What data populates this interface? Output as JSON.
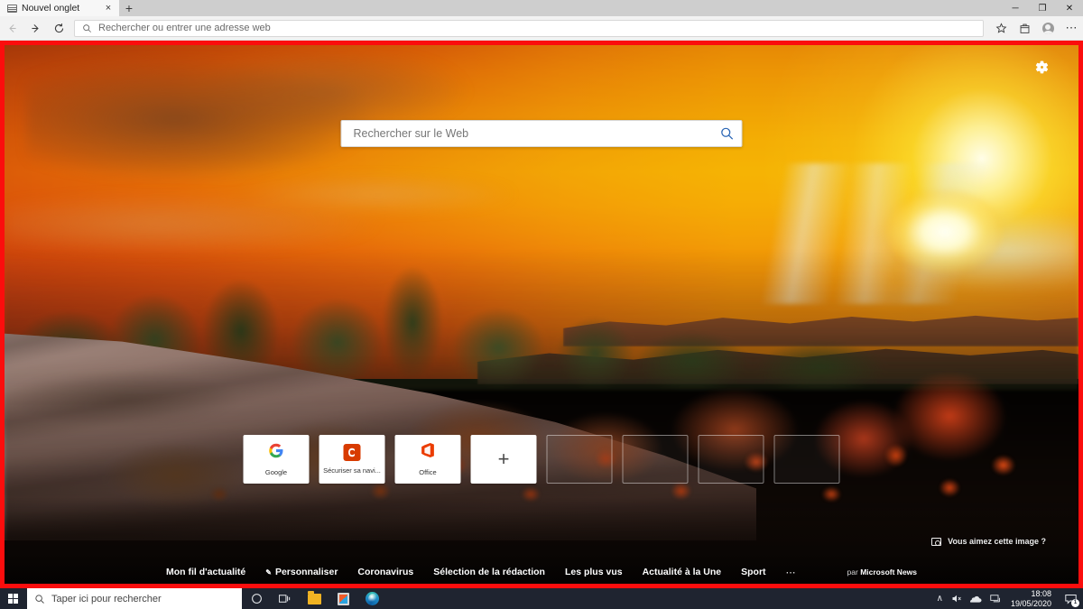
{
  "browser": {
    "tab": {
      "title": "Nouvel onglet",
      "favicon": "page-icon",
      "close_label": "×"
    },
    "new_tab_label": "+",
    "window_controls": {
      "minimize": "─",
      "maximize": "❐",
      "close": "✕"
    },
    "nav": {
      "back": "←",
      "forward": "→",
      "refresh": "↻"
    },
    "address": {
      "placeholder": "Rechercher ou entrer une adresse web",
      "value": "",
      "icon": "search-icon"
    },
    "toolbar_right": {
      "favorite": "☆",
      "collections": "collections-icon",
      "profile": "avatar-icon",
      "more": "⋯"
    }
  },
  "newtab": {
    "settings_icon": "gear-icon",
    "search": {
      "placeholder": "Rechercher sur le Web",
      "value": "",
      "go_icon": "search-icon"
    },
    "tiles": [
      {
        "label": "Google",
        "icon": "google-icon",
        "icon_color": "#4285f4"
      },
      {
        "label": "Sécuriser sa navi...",
        "icon": "shield-c-icon",
        "icon_color": "#d83b01",
        "glyph": "C"
      },
      {
        "label": "Office",
        "icon": "office-icon",
        "icon_color": "#d83b01",
        "glyph": "◗"
      },
      {
        "label": "",
        "icon": "plus-icon",
        "add_glyph": "+"
      }
    ],
    "ghost_tiles": 4,
    "image_feedback": {
      "icon": "camera-icon",
      "label": "Vous aimez cette image ?"
    },
    "news_nav": [
      {
        "label": "Mon fil d'actualité",
        "icon": ""
      },
      {
        "label": "Personnaliser",
        "icon": "pencil-icon"
      },
      {
        "label": "Coronavirus",
        "icon": ""
      },
      {
        "label": "Sélection de la rédaction",
        "icon": ""
      },
      {
        "label": "Les plus vus",
        "icon": ""
      },
      {
        "label": "Actualité à la Une",
        "icon": ""
      },
      {
        "label": "Sport",
        "icon": ""
      }
    ],
    "news_more": "⋯",
    "news_credit_prefix": "par ",
    "news_credit_brand": "Microsoft News"
  },
  "taskbar": {
    "start_label": "start-button",
    "search": {
      "placeholder": "Taper ici pour rechercher",
      "icon": "search-icon"
    },
    "cortana_icon": "cortana-circle-icon",
    "taskview_icon": "task-view-icon",
    "pinned": [
      {
        "name": "file-explorer",
        "label": "Explorateur de fichiers"
      },
      {
        "name": "microsoft-store",
        "label": "Microsoft Store"
      },
      {
        "name": "microsoft-edge",
        "label": "Microsoft Edge"
      }
    ],
    "tray": {
      "chevron": "∧",
      "volume": "volume-muted-icon",
      "cloud": "onedrive-icon",
      "network": "network-icon"
    },
    "clock": {
      "time": "18:08",
      "date": "19/05/2020"
    },
    "notifications": {
      "icon": "action-center-icon",
      "count": "1"
    }
  },
  "highlight": {
    "border_color": "#fb0d0d"
  }
}
